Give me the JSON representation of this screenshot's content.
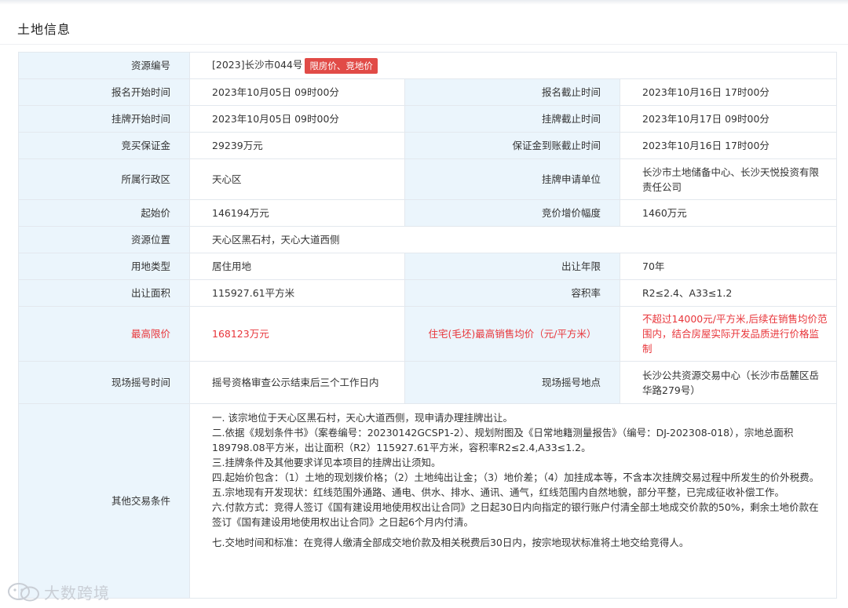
{
  "panel": {
    "title": "土地信息"
  },
  "resource_id": {
    "label": "资源编号",
    "value": "[2023]长沙市044号",
    "badge": "限房价、竞地价"
  },
  "rows": [
    {
      "l1": "报名开始时间",
      "v1": "2023年10月05日 09时00分",
      "l2": "报名截止时间",
      "v2": "2023年10月16日 17时00分"
    },
    {
      "l1": "挂牌开始时间",
      "v1": "2023年10月05日 09时00分",
      "l2": "挂牌截止时间",
      "v2": "2023年10月17日 09时00分"
    },
    {
      "l1": "竞买保证金",
      "v1": "29239万元",
      "l2": "保证金到账截止时间",
      "v2": "2023年10月16日 17时00分"
    },
    {
      "l1": "所属行政区",
      "v1": "天心区",
      "l2": "挂牌申请单位",
      "v2": "长沙市土地储备中心、长沙天悦投资有限责任公司"
    },
    {
      "l1": "起始价",
      "v1": "146194万元",
      "l2": "竞价增价幅度",
      "v2": "1460万元"
    }
  ],
  "location": {
    "label": "资源位置",
    "value": "天心区黑石村，天心大道西侧"
  },
  "rows2": [
    {
      "l1": "用地类型",
      "v1": "居住用地",
      "l2": "出让年限",
      "v2": "70年"
    },
    {
      "l1": "出让面积",
      "v1": "115927.61平方米",
      "l2": "容积率",
      "v2": "R2≤2.4、A33≤1.2"
    }
  ],
  "price_cap": {
    "l1": "最高限价",
    "v1": "168123万元",
    "l2": "住宅(毛坯)最高销售均价（元/平方米）",
    "v2": "不超过14000元/平方米,后续在销售均价范围内，结合房屋实际开发品质进行价格监制"
  },
  "lottery": {
    "l1": "现场摇号时间",
    "v1": "摇号资格审查公示结束后三个工作日内",
    "l2": "现场摇号地点",
    "v2": "长沙公共资源交易中心（长沙市岳麓区岳华路279号）"
  },
  "conditions": {
    "label": "其他交易条件",
    "items": [
      "一. 该宗地位于天心区黑石村，天心大道西侧，现申请办理挂牌出让。",
      "二.依据《规划条件书》（案卷编号：20230142GCSP1-2）、规划附图及《日常地籍测量报告》（编号：DJ-202308-018），宗地总面积189798.08平方米，出让面积（R2）115927.61平方米，容积率R2≤2.4,A33≤1.2。",
      "三.挂牌条件及其他要求详见本项目的挂牌出让须知。",
      "四.起始价包含：（1）土地的现划拨价格；（2）土地纯出让金；（3）地价差；（4）加挂成本等，不含本次挂牌交易过程中所发生的价外税费。",
      "五.宗地现有开发现状：红线范围外通路、通电、供水、排水、通讯、通气，红线范围内自然地貌，部分平整，已完成征收补偿工作。",
      "六.付款方式：竞得人签订《国有建设用地使用权出让合同》之日起30日内向指定的银行账户付清全部土地成交价款的50%，剩余土地价款在签订《国有建设用地使用权出让合同》之日起6个月内付清。",
      "七.交地时间和标准：在竞得人缴清全部成交地价款及相关税费后30日内，按宗地现状标准将土地交给竞得人。"
    ]
  },
  "watermark": {
    "text": "大数跨境",
    "icon": "wechat-logo-icon"
  }
}
